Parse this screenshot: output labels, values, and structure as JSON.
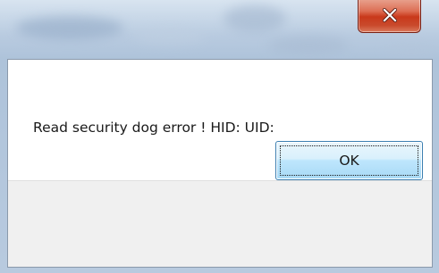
{
  "dialog": {
    "close_icon": "close-icon",
    "message": "Read security dog error !  HID: UID:",
    "ok_label": "OK"
  },
  "colors": {
    "close_button": "#c9391b",
    "ok_border": "#3c7fb1",
    "button_bar": "#f0f0f0"
  }
}
